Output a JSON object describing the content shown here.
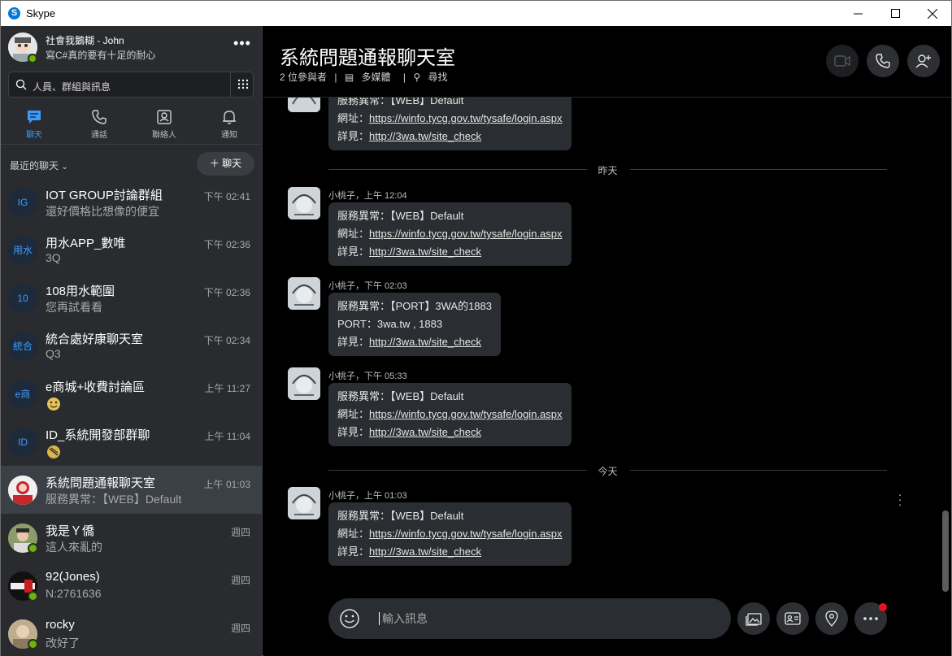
{
  "window": {
    "title": "Skype",
    "app_icon": "skype-logo-icon"
  },
  "profile": {
    "name": "社會我鵝糊 - John",
    "mood": "寫C#真的要有十足的耐心",
    "status": "online"
  },
  "search": {
    "placeholder": "人員、群組與訊息"
  },
  "nav": {
    "tabs": [
      {
        "label": "聊天",
        "icon": "chat-icon",
        "active": true
      },
      {
        "label": "通話",
        "icon": "phone-icon",
        "active": false
      },
      {
        "label": "聯絡人",
        "icon": "contacts-icon",
        "active": false
      },
      {
        "label": "通知",
        "icon": "bell-icon",
        "active": false
      }
    ]
  },
  "recent": {
    "label": "最近的聊天",
    "new_chat_label": "＋ 聊天"
  },
  "chats": [
    {
      "initials": "IG",
      "name": "IOT GROUP討論群組",
      "message": "還好價格比想像的便宜",
      "time": "下午 02:41"
    },
    {
      "initials": "用水",
      "name": "用水APP_數唯",
      "message": "3Q",
      "time": "下午 02:36"
    },
    {
      "initials": "10",
      "name": "108用水範圍",
      "message": "您再試看看",
      "time": "下午 02:36"
    },
    {
      "initials": "統合",
      "name": "統合處好康聊天室",
      "message": "Q3",
      "time": "下午 02:34"
    },
    {
      "initials": "e商",
      "name": "e商城+收費討論區",
      "message": "",
      "time": "上午 11:27"
    },
    {
      "initials": "ID",
      "name": "ID_系統開發部群聊",
      "message": "",
      "time": "上午 11:04"
    },
    {
      "initials": "",
      "name": "系統問題通報聊天室",
      "message": "服務異常：【WEB】Default",
      "time": "上午 01:03"
    },
    {
      "initials": "",
      "name": "我是Ｙ僑",
      "message": "這人來亂的",
      "time": "週四"
    },
    {
      "initials": "",
      "name": "92(Jones)",
      "message": "N:2761636",
      "time": "週四"
    },
    {
      "initials": "",
      "name": "rocky",
      "message": "改好了",
      "time": "週四"
    }
  ],
  "conversation": {
    "title": "系統問題通報聊天室",
    "participants": "2 位參與者",
    "media": "多媒體",
    "find": "尋找",
    "sep": "|"
  },
  "messages": {
    "top": {
      "line1": "服務異常：【WEB】Default",
      "line2_label": "網址：",
      "line2_link": "https://winfo.tycg.gov.tw/tysafe/login.aspx",
      "line3_label": "詳見：",
      "line3_link": "http://3wa.tw/site_check"
    },
    "divider_yesterday": "昨天",
    "m1": {
      "sender": "小桃子，上午 12:04",
      "line1": "服務異常：【WEB】Default",
      "line2_label": "網址：",
      "line2_link": "https://winfo.tycg.gov.tw/tysafe/login.aspx",
      "line3_label": "詳見：",
      "line3_link": "http://3wa.tw/site_check"
    },
    "m2": {
      "sender": "小桃子，下午 02:03",
      "line1": "服務異常：【PORT】3WA的1883",
      "line2": "PORT：3wa.tw , 1883",
      "line3_label": "詳見：",
      "line3_link": "http://3wa.tw/site_check"
    },
    "m3": {
      "sender": "小桃子，下午 05:33",
      "line1": "服務異常：【WEB】Default",
      "line2_label": "網址：",
      "line2_link": "https://winfo.tycg.gov.tw/tysafe/login.aspx",
      "line3_label": "詳見：",
      "line3_link": "http://3wa.tw/site_check"
    },
    "divider_today": "今天",
    "m4": {
      "sender": "小桃子，上午 01:03",
      "line1": "服務異常：【WEB】Default",
      "line2_label": "網址：",
      "line2_link": "https://winfo.tycg.gov.tw/tysafe/login.aspx",
      "line3_label": "詳見：",
      "line3_link": "http://3wa.tw/site_check"
    }
  },
  "composer": {
    "placeholder": "輸入訊息"
  },
  "colors": {
    "accent": "#3b9cff",
    "online": "#6bb700",
    "notification": "#e81123"
  }
}
